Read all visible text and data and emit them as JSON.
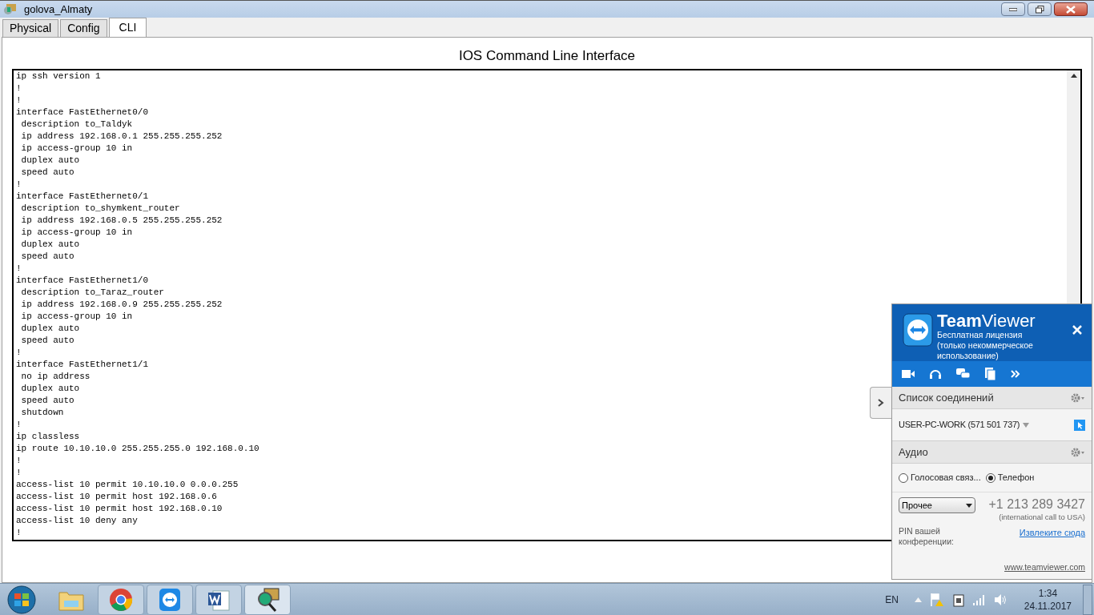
{
  "window": {
    "title": "golova_Almaty"
  },
  "tabs": [
    {
      "label": "Physical",
      "selected": false
    },
    {
      "label": "Config",
      "selected": false
    },
    {
      "label": "CLI",
      "selected": true
    }
  ],
  "cli": {
    "heading": "IOS Command Line Interface",
    "lines": [
      "ip ssh version 1",
      "!",
      "!",
      "interface FastEthernet0/0",
      " description to_Taldyk",
      " ip address 192.168.0.1 255.255.255.252",
      " ip access-group 10 in",
      " duplex auto",
      " speed auto",
      "!",
      "interface FastEthernet0/1",
      " description to_shymkent_router",
      " ip address 192.168.0.5 255.255.255.252",
      " ip access-group 10 in",
      " duplex auto",
      " speed auto",
      "!",
      "interface FastEthernet1/0",
      " description to_Taraz_router",
      " ip address 192.168.0.9 255.255.255.252",
      " ip access-group 10 in",
      " duplex auto",
      " speed auto",
      "!",
      "interface FastEthernet1/1",
      " no ip address",
      " duplex auto",
      " speed auto",
      " shutdown",
      "!",
      "ip classless",
      "ip route 10.10.10.0 255.255.255.0 192.168.0.10",
      "!",
      "!",
      "access-list 10 permit 10.10.10.0 0.0.0.255",
      "access-list 10 permit host 192.168.0.6",
      "access-list 10 permit host 192.168.0.10",
      "access-list 10 deny any",
      "!"
    ]
  },
  "teamviewer": {
    "brand_bold": "Team",
    "brand_light": "Viewer",
    "license": "Бесплатная лицензия (только некоммерческое использование)",
    "connections_title": "Список соединений",
    "connection": "USER-PC-WORK (571 501 737)",
    "audio_title": "Аудио",
    "audio_options": [
      {
        "label": "Голосовая связ...",
        "selected": false
      },
      {
        "label": "Телефон",
        "selected": true
      }
    ],
    "country": "Прочее",
    "phone": "+1 213 289 3427",
    "phone_note": "(international call to USA)",
    "pin_label": "PIN вашей конференции:",
    "pin_link": "Извлеките сюда",
    "site": "www.teamviewer.com"
  },
  "taskbar": {
    "language": "EN",
    "time": "1:34",
    "date": "24.11.2017"
  }
}
